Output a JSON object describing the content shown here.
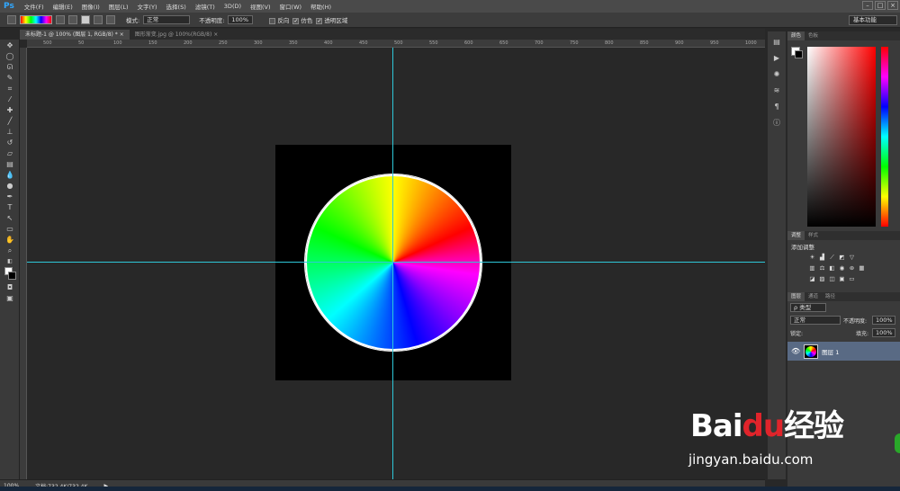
{
  "app_logo": "Ps",
  "menu": [
    "文件(F)",
    "编辑(E)",
    "图像(I)",
    "图层(L)",
    "文字(Y)",
    "选择(S)",
    "滤镜(T)",
    "3D(D)",
    "视图(V)",
    "窗口(W)",
    "帮助(H)"
  ],
  "window_controls": [
    "–",
    "□",
    "×"
  ],
  "options": {
    "mode_label": "模式:",
    "mode_value": "正常",
    "opacity_label": "不透明度:",
    "opacity_value": "100%",
    "reverse": "反向",
    "dither": "仿色",
    "transparency": "透明区域",
    "workspace": "基本功能"
  },
  "tabs": [
    {
      "label": "未标题-1 @ 100% (图层 1, RGB/8) *",
      "close": "×"
    },
    {
      "label": "图形渐变.jpg @ 100%(RGB/8)",
      "close": "×"
    }
  ],
  "ruler_ticks": [
    "500",
    "50",
    "100",
    "150",
    "200",
    "250",
    "300",
    "350",
    "400",
    "450",
    "500",
    "550",
    "600",
    "650",
    "700",
    "750",
    "800",
    "850",
    "900",
    "950",
    "1000"
  ],
  "status": {
    "zoom": "100%",
    "doc": "文档:732.4K/732.4K",
    "arrow": "▶"
  },
  "panels": {
    "color_tabs": [
      "颜色",
      "色板"
    ],
    "adjust_tabs": [
      "调整",
      "样式"
    ],
    "adjust_title": "添加调整",
    "layer_tabs": [
      "图层",
      "通道",
      "路径"
    ],
    "kind_label": "ρ 类型",
    "blend_mode": "正常",
    "opacity_label": "不透明度:",
    "opacity_value": "100%",
    "lock_label": "锁定:",
    "fill_label": "填充:",
    "fill_value": "100%",
    "layer_name": "图层 1"
  },
  "watermark": {
    "logo_a": "Bai",
    "logo_b": "du",
    "logo_c": "经验",
    "url": "jingyan.baidu.com"
  }
}
